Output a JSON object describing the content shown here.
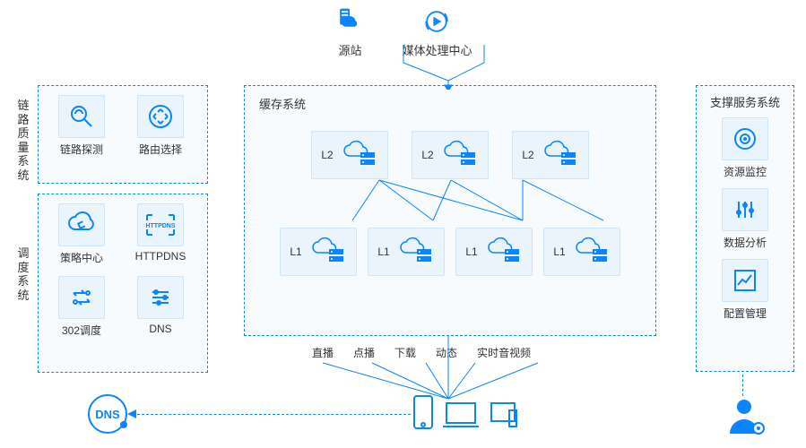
{
  "top": {
    "origin": "源站",
    "media_center": "媒体处理中心"
  },
  "left": {
    "quality_label": "链路质量系统",
    "schedule_label": "调度系统",
    "probe": "链路探测",
    "route": "路由选择",
    "policy": "策略中心",
    "httpdns": "HTTPDNS",
    "httpdns_icon_text": "HTTPDNS",
    "r302": "302调度",
    "dns": "DNS"
  },
  "center": {
    "title": "缓存系统",
    "l2": [
      "L2",
      "L2",
      "L2"
    ],
    "l1": [
      "L1",
      "L1",
      "L1",
      "L1"
    ]
  },
  "right": {
    "title": "支撑服务系统",
    "monitor": "资源监控",
    "analytics": "数据分析",
    "config": "配置管理"
  },
  "services": [
    "直播",
    "点播",
    "下载",
    "动态",
    "实时音视频"
  ],
  "dns_label": "DNS"
}
